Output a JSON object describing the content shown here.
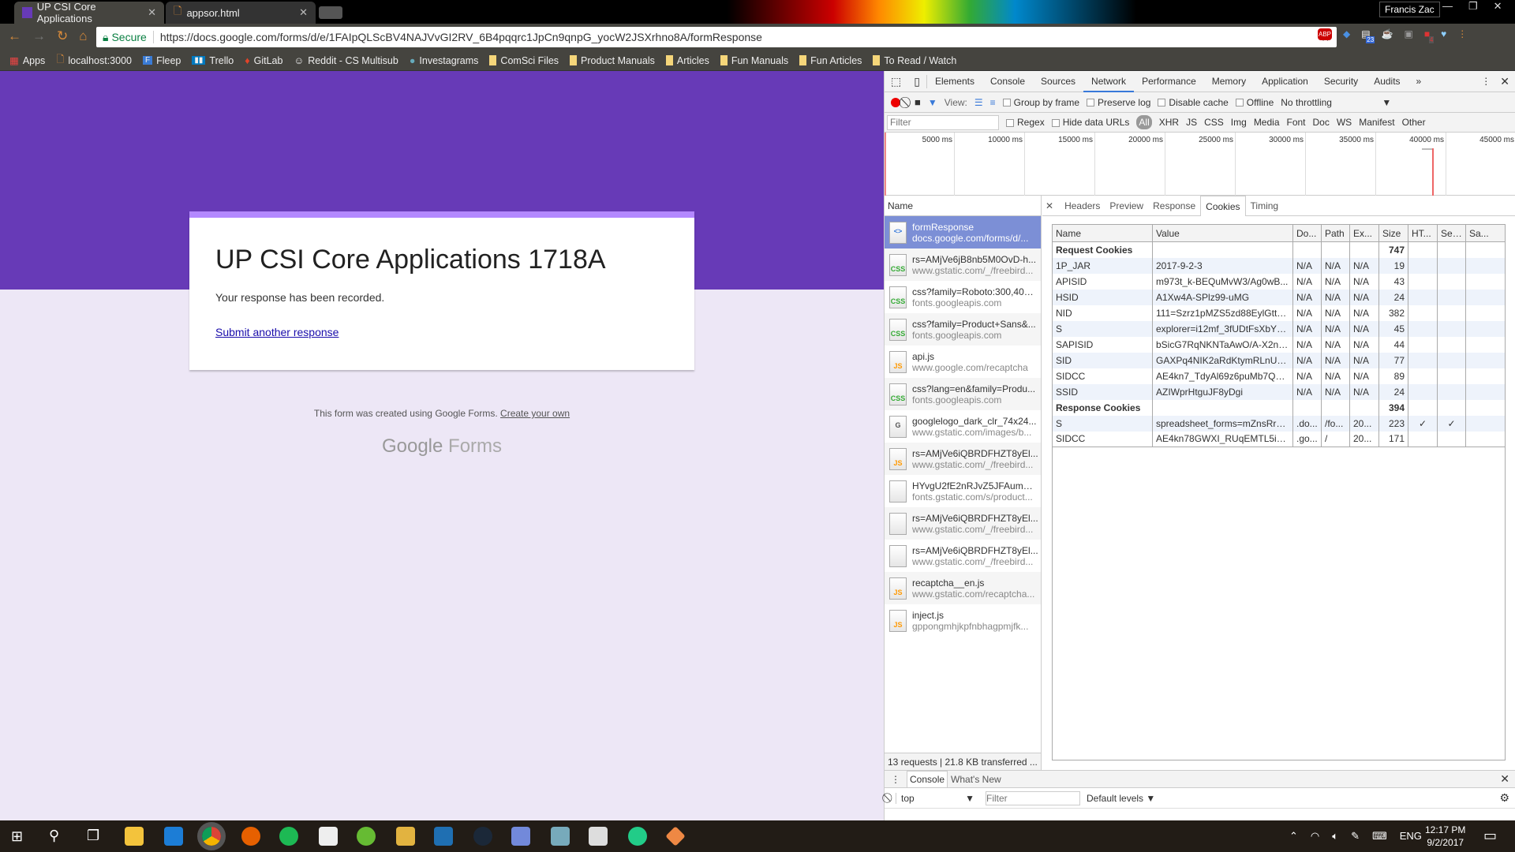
{
  "browser": {
    "tabs": [
      {
        "title": "UP CSI Core Applications",
        "active": true
      },
      {
        "title": "appsor.html",
        "active": false
      }
    ],
    "profile": "Francis Zac",
    "secure_label": "Secure",
    "url": "https://docs.google.com/forms/d/e/1FAIpQLScBV4NAJVvGI2RV_6B4pqqrc1JpCn9qnpG_yocW2JSXrhno8A/formResponse",
    "bookmarks": [
      "Apps",
      "localhost:3000",
      "Fleep",
      "Trello",
      "GitLab",
      "Reddit - CS Multisub",
      "Investagrams",
      "ComSci Files",
      "Product Manuals",
      "Articles",
      "Fun Manuals",
      "Fun Articles",
      "To Read / Watch"
    ],
    "extension_badges": [
      "23",
      "4"
    ]
  },
  "form": {
    "title": "UP CSI Core Applications 1718A",
    "message": "Your response has been recorded.",
    "link": "Submit another response",
    "footer": "This form was created using Google Forms.",
    "footer_link": "Create your own",
    "logo_google": "Google",
    "logo_forms": "Forms",
    "colors": {
      "header": "#673ab7",
      "accent": "#b388ff",
      "bg": "#ede7f6"
    }
  },
  "devtools": {
    "tabs": [
      "Elements",
      "Console",
      "Sources",
      "Network",
      "Performance",
      "Memory",
      "Application",
      "Security",
      "Audits"
    ],
    "active_tab": "Network",
    "toolbar": {
      "view": "View:",
      "group_by_frame": "Group by frame",
      "preserve_log": "Preserve log",
      "disable_cache": "Disable cache",
      "offline": "Offline",
      "throttling": "No throttling"
    },
    "filter": {
      "placeholder": "Filter",
      "regex": "Regex",
      "hide_data": "Hide data URLs",
      "types": [
        "All",
        "XHR",
        "JS",
        "CSS",
        "Img",
        "Media",
        "Font",
        "Doc",
        "WS",
        "Manifest",
        "Other"
      ]
    },
    "timeline_ticks": [
      "5000 ms",
      "10000 ms",
      "15000 ms",
      "20000 ms",
      "25000 ms",
      "30000 ms",
      "35000 ms",
      "40000 ms",
      "45000 ms"
    ],
    "name_header": "Name",
    "requests": [
      {
        "name": "formResponse",
        "url": "docs.google.com/forms/d/...",
        "type": "doc"
      },
      {
        "name": "rs=AMjVe6jB8nb5M0OvD-h...",
        "url": "www.gstatic.com/_/freebird...",
        "type": "CSS"
      },
      {
        "name": "css?family=Roboto:300,400,...",
        "url": "fonts.googleapis.com",
        "type": "CSS"
      },
      {
        "name": "css?family=Product+Sans&...",
        "url": "fonts.googleapis.com",
        "type": "CSS"
      },
      {
        "name": "api.js",
        "url": "www.google.com/recaptcha",
        "type": "JS"
      },
      {
        "name": "css?lang=en&family=Produ...",
        "url": "fonts.googleapis.com",
        "type": "CSS"
      },
      {
        "name": "googlelogo_dark_clr_74x24...",
        "url": "www.gstatic.com/images/b...",
        "type": "img"
      },
      {
        "name": "rs=AMjVe6iQBRDFHZT8yEl...",
        "url": "www.gstatic.com/_/freebird...",
        "type": "JS"
      },
      {
        "name": "HYvgU2fE2nRJvZ5JFAumwe...",
        "url": "fonts.gstatic.com/s/product...",
        "type": ""
      },
      {
        "name": "rs=AMjVe6iQBRDFHZT8yEl...",
        "url": "www.gstatic.com/_/freebird...",
        "type": ""
      },
      {
        "name": "rs=AMjVe6iQBRDFHZT8yEl...",
        "url": "www.gstatic.com/_/freebird...",
        "type": ""
      },
      {
        "name": "recaptcha__en.js",
        "url": "www.gstatic.com/recaptcha...",
        "type": "JS"
      },
      {
        "name": "inject.js",
        "url": "gppongmhjkpfnbhagpmjfk...",
        "type": "JS"
      }
    ],
    "detail_tabs": [
      "Headers",
      "Preview",
      "Response",
      "Cookies",
      "Timing"
    ],
    "active_detail_tab": "Cookies",
    "cookie_headers": [
      "Name",
      "Value",
      "Do...",
      "Path",
      "Ex...",
      "Size",
      "HT...",
      "Sec...",
      "Sa..."
    ],
    "request_cookies_label": "Request Cookies",
    "request_cookies_size": "747",
    "request_cookies": [
      [
        "1P_JAR",
        "2017-9-2-3",
        "N/A",
        "N/A",
        "N/A",
        "19",
        "",
        ""
      ],
      [
        "APISID",
        "m973t_k-BEQuMvW3/Ag0wB...",
        "N/A",
        "N/A",
        "N/A",
        "43",
        "",
        ""
      ],
      [
        "HSID",
        "A1Xw4A-SPlz99-uMG",
        "N/A",
        "N/A",
        "N/A",
        "24",
        "",
        ""
      ],
      [
        "NID",
        "111=Szrz1pMZS5zd88EylGttY...",
        "N/A",
        "N/A",
        "N/A",
        "382",
        "",
        ""
      ],
      [
        "S",
        "explorer=i12mf_3fUDtFsXbYL...",
        "N/A",
        "N/A",
        "N/A",
        "45",
        "",
        ""
      ],
      [
        "SAPISID",
        "bSicG7RqNKNTaAwO/A-X2n6...",
        "N/A",
        "N/A",
        "N/A",
        "44",
        "",
        ""
      ],
      [
        "SID",
        "GAXPq4NIK2aRdKtymRLnUTh...",
        "N/A",
        "N/A",
        "N/A",
        "77",
        "",
        ""
      ],
      [
        "SIDCC",
        "AE4kn7_TdyAl69z6puMb7Q_l...",
        "N/A",
        "N/A",
        "N/A",
        "89",
        "",
        ""
      ],
      [
        "SSID",
        "AZIWprHtguJF8yDgi",
        "N/A",
        "N/A",
        "N/A",
        "24",
        "",
        ""
      ]
    ],
    "response_cookies_label": "Response Cookies",
    "response_cookies_size": "394",
    "response_cookies": [
      [
        "S",
        "spreadsheet_forms=mZnsRrn...",
        ".do...",
        "/fo...",
        "20...",
        "223",
        "✓",
        "✓"
      ],
      [
        "SIDCC",
        "AE4kn78GWXI_RUqEMTL5iDP...",
        ".go...",
        "/",
        "20...",
        "171",
        "",
        ""
      ]
    ],
    "status": "13 requests | 21.8 KB transferred ...",
    "drawer": {
      "tabs": [
        "Console",
        "What's New"
      ],
      "context": "top",
      "filter_placeholder": "Filter",
      "levels": "Default levels"
    }
  },
  "taskbar": {
    "lang": "ENG",
    "time": "12:17 PM",
    "date": "9/2/2017"
  }
}
